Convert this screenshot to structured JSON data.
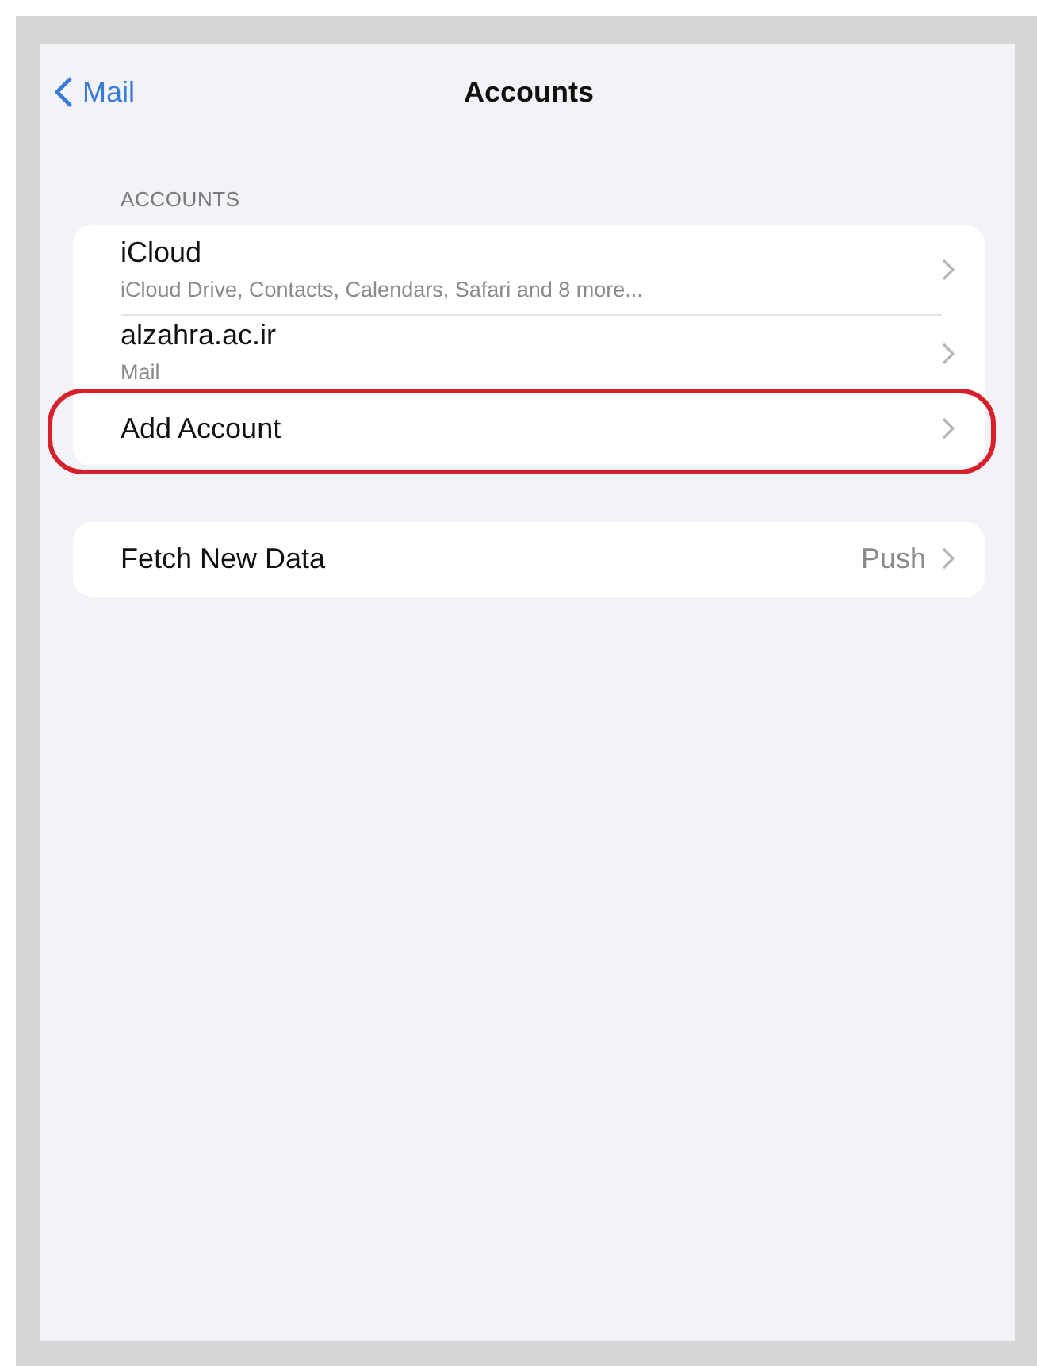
{
  "nav_bar": {
    "back_label": "Mail",
    "title": "Accounts"
  },
  "sections": [
    {
      "header": "ACCOUNTS",
      "rows": [
        {
          "title": "iCloud",
          "subtitle": "iCloud Drive, Contacts, Calendars, Safari and 8 more...",
          "highlighted": false
        },
        {
          "title": "alzahra.ac.ir",
          "subtitle": "Mail",
          "highlighted": false
        },
        {
          "title": "Add Account",
          "highlighted": true
        }
      ]
    },
    {
      "rows": [
        {
          "title": "Fetch New Data",
          "value": "Push",
          "highlighted": false
        }
      ]
    }
  ]
}
